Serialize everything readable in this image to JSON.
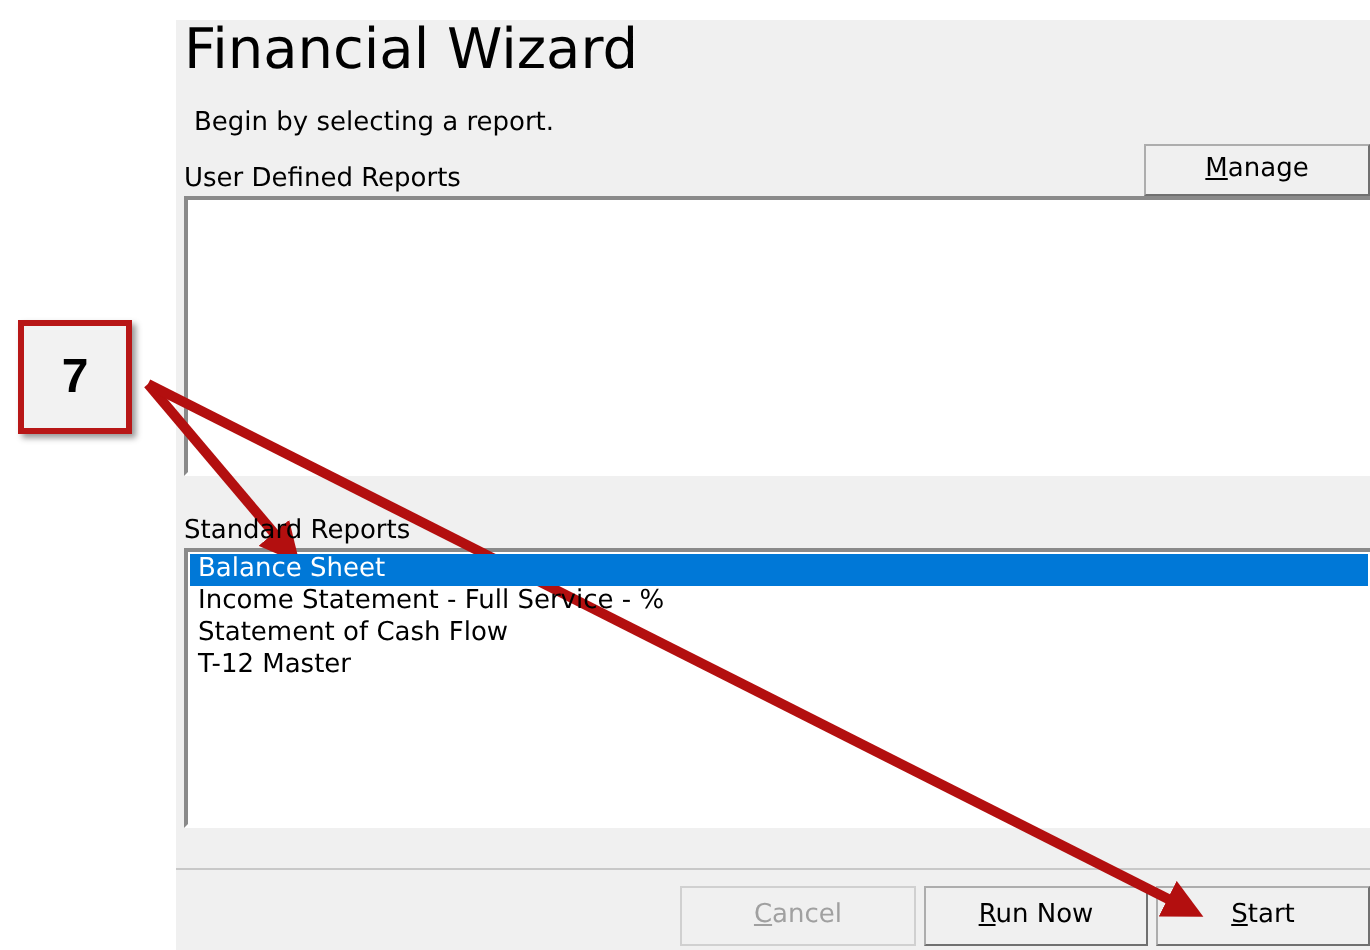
{
  "window": {
    "title": "Financial Wizard",
    "instruction": "Begin by selecting a report."
  },
  "user_defined_reports": {
    "label": "User Defined Reports"
  },
  "manage_button": {
    "label": "Manage",
    "disabled": false
  },
  "standard_reports": {
    "label": "Standard Reports",
    "items": [
      {
        "label": "Balance Sheet",
        "selected": true
      },
      {
        "label": "Income Statement - Full Service - %",
        "selected": false
      },
      {
        "label": "Statement of Cash Flow",
        "selected": false
      },
      {
        "label": "T-12 Master",
        "selected": false
      }
    ]
  },
  "buttons": [
    {
      "label": "Cancel",
      "disabled": true
    },
    {
      "label": "Run Now",
      "disabled": false
    },
    {
      "label": "Start",
      "disabled": false
    }
  ],
  "callout": {
    "label": "7"
  }
}
